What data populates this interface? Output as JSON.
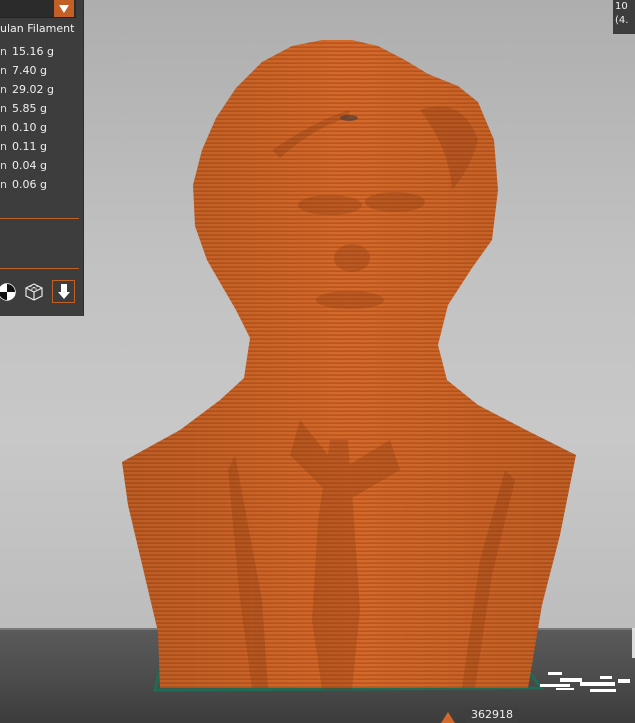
{
  "panel": {
    "header": "ulan Filament",
    "rows": [
      {
        "tick": "n",
        "weight": "15.16 g"
      },
      {
        "tick": "n",
        "weight": "7.40 g"
      },
      {
        "tick": "n",
        "weight": "29.02 g"
      },
      {
        "tick": "n",
        "weight": "5.85 g"
      },
      {
        "tick": "n",
        "weight": "0.10 g"
      },
      {
        "tick": "n",
        "weight": "0.11 g"
      },
      {
        "tick": "n",
        "weight": "0.04 g"
      },
      {
        "tick": "n",
        "weight": "0.06 g"
      }
    ],
    "tools": [
      "contrast-toggle-icon",
      "wireframe-cube-icon",
      "export-download-icon"
    ]
  },
  "topright": {
    "line1": "10",
    "line2": "(4."
  },
  "slider": {
    "layer_value": "362918"
  },
  "colors": {
    "accent": "#c26025",
    "model": "#d2692a",
    "panel": "#3d3d3d",
    "bed_outline": "#1f6b55"
  }
}
